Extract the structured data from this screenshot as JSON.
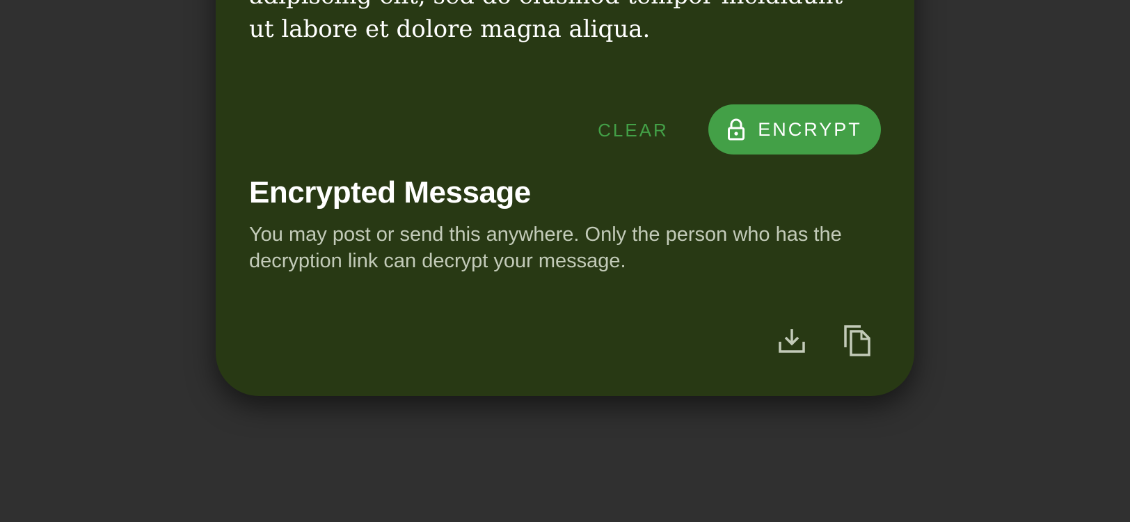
{
  "input": {
    "text": "adipiscing elit, sed do eiusmod tempor incididunt\nut labore et dolore magna aliqua."
  },
  "actions": {
    "clear_label": "CLEAR",
    "encrypt_label": "ENCRYPT"
  },
  "output": {
    "title": "Encrypted Message",
    "description": "You may post or send this anywhere. Only the person who has the decryption link can decrypt your message."
  },
  "icons": {
    "lock": "lock-icon",
    "download": "download-icon",
    "copy": "copy-icon"
  },
  "colors": {
    "background": "#303030",
    "card": "#283914",
    "accent": "#43a047",
    "text": "#ffffff",
    "muted_text": "#c3cbb9"
  }
}
